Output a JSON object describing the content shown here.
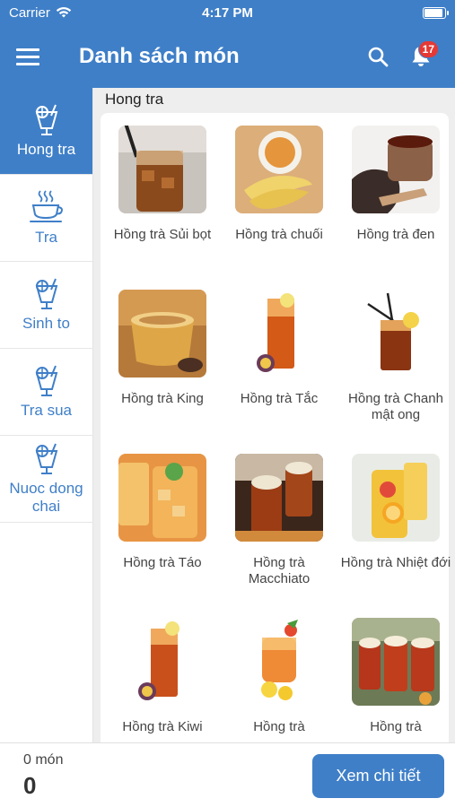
{
  "status_bar": {
    "carrier": "Carrier",
    "time": "4:17 PM"
  },
  "header": {
    "title": "Danh sách món",
    "notification_count": "17"
  },
  "sidebar": {
    "categories": [
      {
        "label": "Hong tra",
        "icon": "drink-icon",
        "active": true
      },
      {
        "label": "Tra",
        "icon": "tea-cup-icon",
        "active": false
      },
      {
        "label": "Sinh to",
        "icon": "drink-icon",
        "active": false
      },
      {
        "label": "Tra sua",
        "icon": "drink-icon",
        "active": false
      },
      {
        "label": "Nuoc dong chai",
        "icon": "drink-icon",
        "active": false
      }
    ]
  },
  "main": {
    "section_title": "Hong tra",
    "items": [
      {
        "name": "Hồng trà Sủi bọt"
      },
      {
        "name": "Hồng trà chuối"
      },
      {
        "name": "Hồng trà đen"
      },
      {
        "name": "Hồng trà King"
      },
      {
        "name": "Hồng trà Tắc"
      },
      {
        "name": "Hồng trà Chanh mật ong"
      },
      {
        "name": "Hồng trà Táo"
      },
      {
        "name": "Hồng trà Macchiato"
      },
      {
        "name": "Hồng trà Nhiệt đới"
      },
      {
        "name": "Hồng trà Kiwi"
      },
      {
        "name": "Hồng trà"
      },
      {
        "name": "Hồng trà"
      }
    ]
  },
  "footer": {
    "count_label": "0 món",
    "count_value": "0",
    "detail_button": "Xem chi tiết"
  },
  "colors": {
    "primary": "#3f7fc8",
    "badge": "#e53935"
  }
}
